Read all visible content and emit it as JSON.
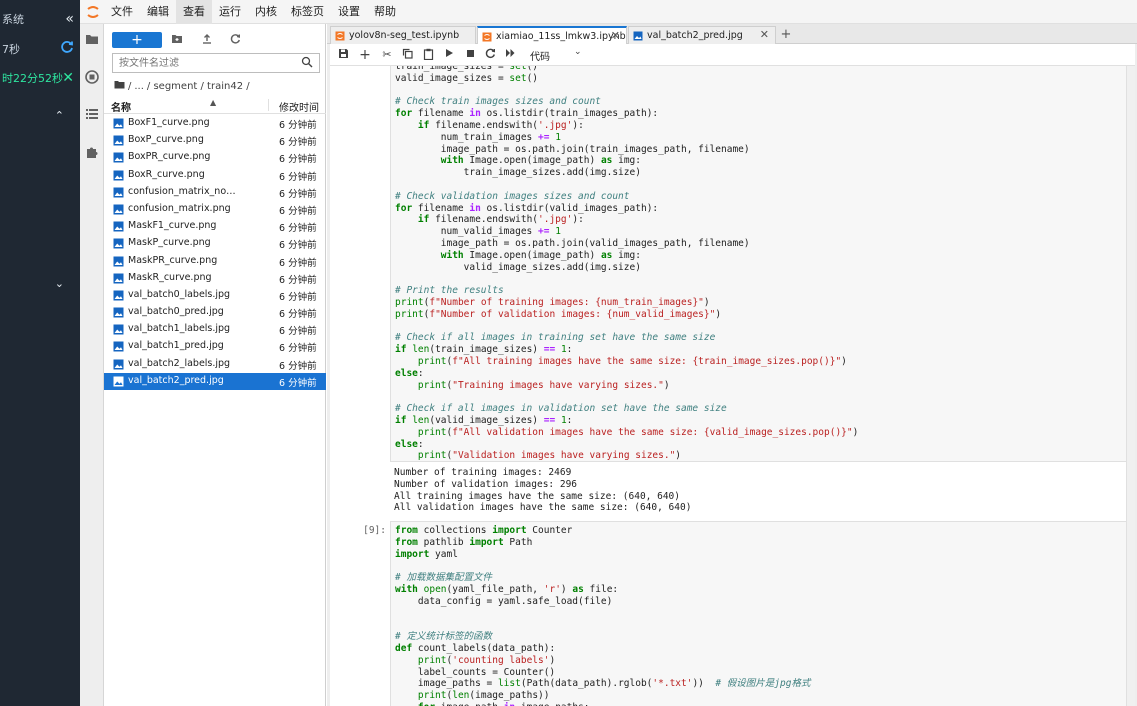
{
  "outer_panel": {
    "line1": "系统",
    "line2": "7秒",
    "line3": "时22分52秒"
  },
  "menubar": {
    "items": [
      "文件",
      "编辑",
      "查看",
      "运行",
      "内核",
      "标签页",
      "设置",
      "帮助"
    ],
    "active_index": 2
  },
  "filebrowser": {
    "new_button": "+",
    "filter_placeholder": "按文件名过滤",
    "breadcrumb": [
      "/",
      "...",
      "/ segment / train42 /"
    ],
    "header_name": "名称",
    "header_modified": "修改时间",
    "files": [
      {
        "name": "BoxF1_curve.png",
        "time": "6 分钟前"
      },
      {
        "name": "BoxP_curve.png",
        "time": "6 分钟前"
      },
      {
        "name": "BoxPR_curve.png",
        "time": "6 分钟前"
      },
      {
        "name": "BoxR_curve.png",
        "time": "6 分钟前"
      },
      {
        "name": "confusion_matrix_nor...",
        "time": "6 分钟前"
      },
      {
        "name": "confusion_matrix.png",
        "time": "6 分钟前"
      },
      {
        "name": "MaskF1_curve.png",
        "time": "6 分钟前"
      },
      {
        "name": "MaskP_curve.png",
        "time": "6 分钟前"
      },
      {
        "name": "MaskPR_curve.png",
        "time": "6 分钟前"
      },
      {
        "name": "MaskR_curve.png",
        "time": "6 分钟前"
      },
      {
        "name": "val_batch0_labels.jpg",
        "time": "6 分钟前"
      },
      {
        "name": "val_batch0_pred.jpg",
        "time": "6 分钟前"
      },
      {
        "name": "val_batch1_labels.jpg",
        "time": "6 分钟前"
      },
      {
        "name": "val_batch1_pred.jpg",
        "time": "6 分钟前"
      },
      {
        "name": "val_batch2_labels.jpg",
        "time": "6 分钟前"
      },
      {
        "name": "val_batch2_pred.jpg",
        "time": "6 分钟前"
      }
    ],
    "selected_index": 15
  },
  "tabs": [
    {
      "label": "yolov8n-seg_test.ipynb"
    },
    {
      "label": "xiamiao_11ss_lmkw3.ipynb"
    },
    {
      "label": "val_batch2_pred.jpg"
    }
  ],
  "active_tab": 1,
  "notebook_toolbar": {
    "cell_type": "代码"
  },
  "cells": {
    "cell1_prompt": "",
    "cell2_prompt": "[9]:"
  },
  "colors": {
    "accent": "#1976d2",
    "selection": "#1a73d2",
    "outer_panel": "#1f2833",
    "status_green": "#2ee6a0"
  }
}
